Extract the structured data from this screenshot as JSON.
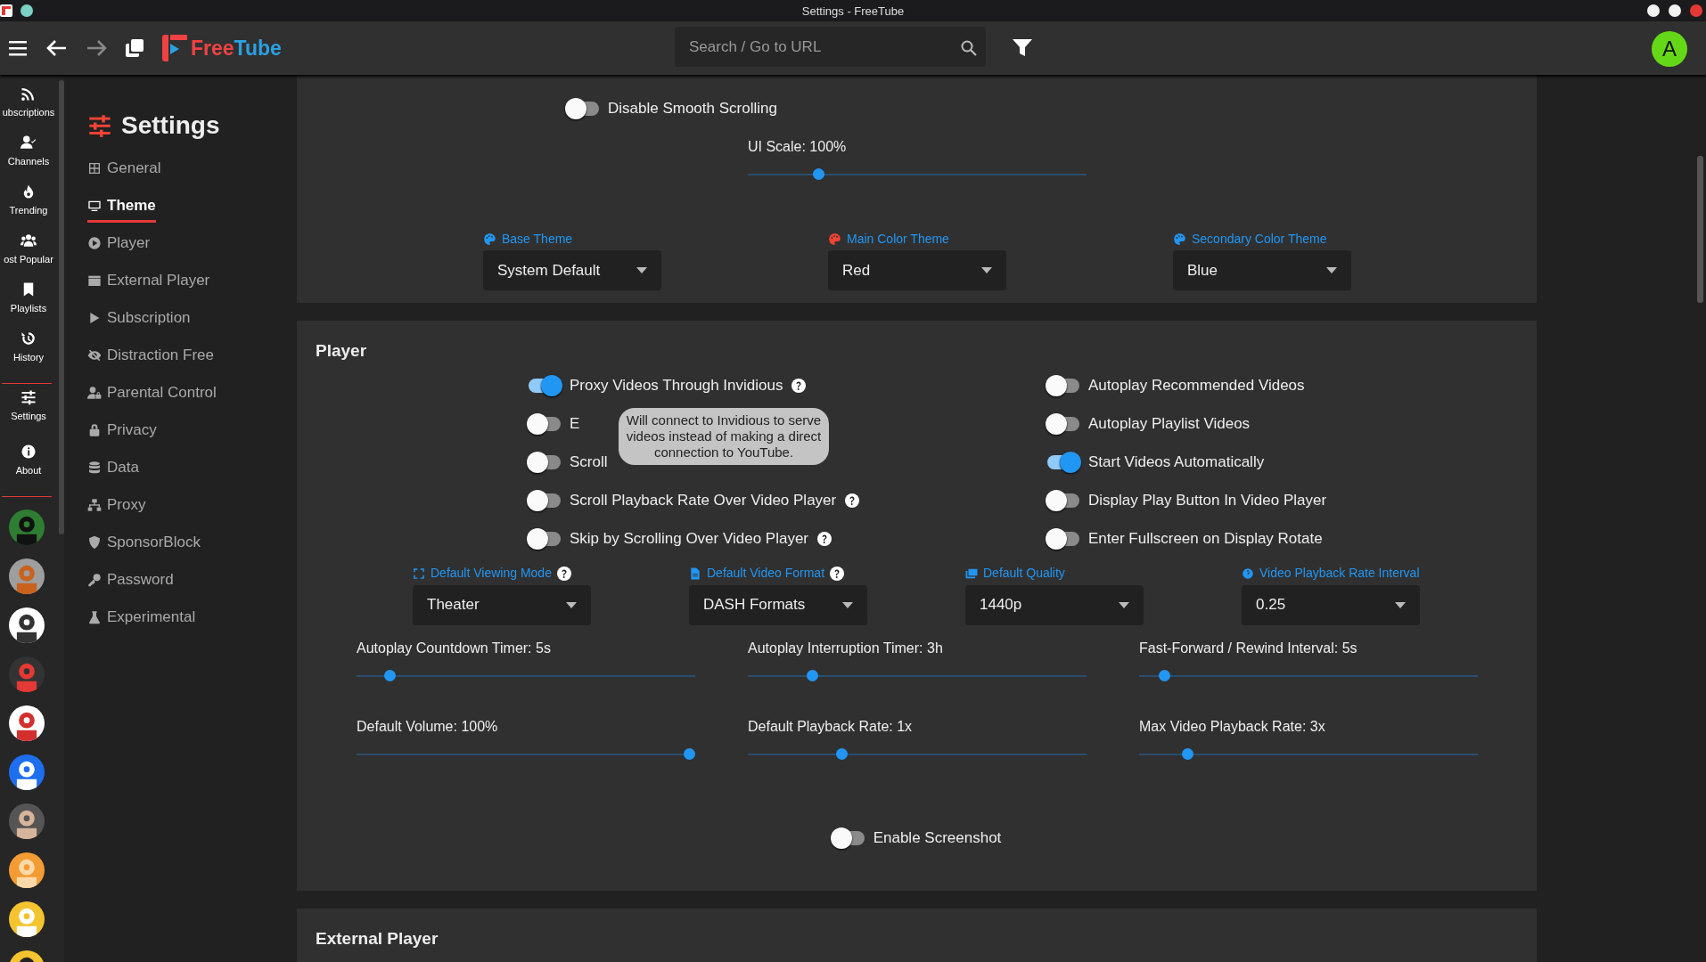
{
  "window": {
    "title": "Settings - FreeTube"
  },
  "header": {
    "logo": [
      "Free",
      "Tube"
    ],
    "search": {
      "placeholder": "Search / Go to URL"
    },
    "avatar": "A"
  },
  "rail": {
    "items": [
      {
        "label": "ubscriptions"
      },
      {
        "label": "Channels"
      },
      {
        "label": "Trending"
      },
      {
        "label": "ost Popular"
      },
      {
        "label": "Playlists"
      },
      {
        "label": "History"
      }
    ],
    "bottom_items": [
      {
        "label": "Settings"
      },
      {
        "label": "About"
      }
    ]
  },
  "settings_nav": {
    "title": "Settings",
    "items": [
      {
        "label": "General",
        "selected": false
      },
      {
        "label": "Theme",
        "selected": true
      },
      {
        "label": "Player",
        "selected": false
      },
      {
        "label": "External Player",
        "selected": false
      },
      {
        "label": "Subscription",
        "selected": false
      },
      {
        "label": "Distraction Free",
        "selected": false
      },
      {
        "label": "Parental Control",
        "selected": false
      },
      {
        "label": "Privacy",
        "selected": false
      },
      {
        "label": "Data",
        "selected": false
      },
      {
        "label": "Proxy",
        "selected": false
      },
      {
        "label": "SponsorBlock",
        "selected": false
      },
      {
        "label": "Password",
        "selected": false
      },
      {
        "label": "Experimental",
        "selected": false
      }
    ]
  },
  "theme_section": {
    "toggle": {
      "label": "Disable Smooth Scrolling",
      "on": false
    },
    "slider": {
      "label": "UI Scale: 100%",
      "level": 0.2
    },
    "dropdowns": [
      {
        "label": "Base Theme",
        "value": "System Default",
        "color": "#2196f3"
      },
      {
        "label": "Main Color Theme",
        "value": "Red",
        "color": "#f44336"
      },
      {
        "label": "Secondary Color Theme",
        "value": "Blue",
        "color": "#2196f3"
      }
    ]
  },
  "player_section": {
    "title": "Player",
    "toggles_left": [
      {
        "label": "Proxy Videos Through Invidious",
        "on": true,
        "help": true
      },
      {
        "label": "E",
        "on": false
      },
      {
        "label": "Scroll",
        "on": false
      },
      {
        "label": "Scroll Playback Rate Over Video Player",
        "on": false,
        "help": true
      },
      {
        "label": "Skip by Scrolling Over Video Player",
        "on": false,
        "help": true
      }
    ],
    "toggles_right": [
      {
        "label": "Autoplay Recommended Videos",
        "on": false
      },
      {
        "label": "Autoplay Playlist Videos",
        "on": false
      },
      {
        "label": "Start Videos Automatically",
        "on": true
      },
      {
        "label": "Display Play Button In Video Player",
        "on": false
      },
      {
        "label": "Enter Fullscreen on Display Rotate",
        "on": false
      }
    ],
    "tooltip": "Will connect to Invidious to serve videos instead of making a direct connection to YouTube.",
    "dropdowns": [
      {
        "label": "Default Viewing Mode",
        "value": "Theater",
        "help": true
      },
      {
        "label": "Default Video Format",
        "value": "DASH Formats",
        "help": true
      },
      {
        "label": "Default Quality",
        "value": "1440p",
        "help": false
      },
      {
        "label": "Video Playback Rate Interval",
        "value": "0.25",
        "help": false
      }
    ],
    "sliders": [
      {
        "label": "Autoplay Countdown Timer: 5s",
        "level": 0.085
      },
      {
        "label": "Autoplay Interruption Timer: 3h",
        "level": 0.18
      },
      {
        "label": "Fast-Forward / Rewind Interval: 5s",
        "level": 0.06
      },
      {
        "label": "Default Volume: 100%",
        "level": 1.0
      },
      {
        "label": "Default Playback Rate: 1x",
        "level": 0.27
      },
      {
        "label": "Max Video Playback Rate: 3x",
        "level": 0.13
      }
    ],
    "bottom_toggle": {
      "label": "Enable Screenshot",
      "on": false
    }
  },
  "external_player_section": {
    "title": "External Player"
  }
}
